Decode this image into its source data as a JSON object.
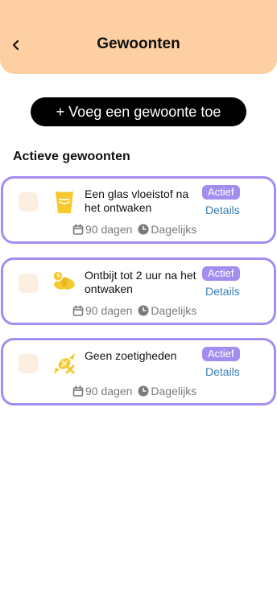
{
  "header": {
    "back_icon": "chevron-left-icon",
    "title": "Gewoonten",
    "background": "#fdcfa3"
  },
  "add_button": {
    "label": "+ Voeg een gewoonte toe"
  },
  "section": {
    "title": "Actieve gewoonten"
  },
  "habits": [
    {
      "icon": "glass-icon",
      "name": "Een glas vloeistof na het ontwaken",
      "status": "Actief",
      "details": "Details",
      "duration": "90 dagen",
      "frequency": "Dagelijks"
    },
    {
      "icon": "croissant-clock-icon",
      "name": "Ontbijt tot 2 uur na het ontwaken",
      "status": "Actief",
      "details": "Details",
      "duration": "90 dagen",
      "frequency": "Dagelijks"
    },
    {
      "icon": "no-candy-icon",
      "name": "Geen zoetigheden",
      "status": "Actief",
      "details": "Details",
      "duration": "90 dagen",
      "frequency": "Dagelijks"
    }
  ],
  "colors": {
    "accent": "#a48df0",
    "icon_yellow": "#f6c92f",
    "link": "#3a7fb5",
    "checkbox": "#fdeee2"
  }
}
